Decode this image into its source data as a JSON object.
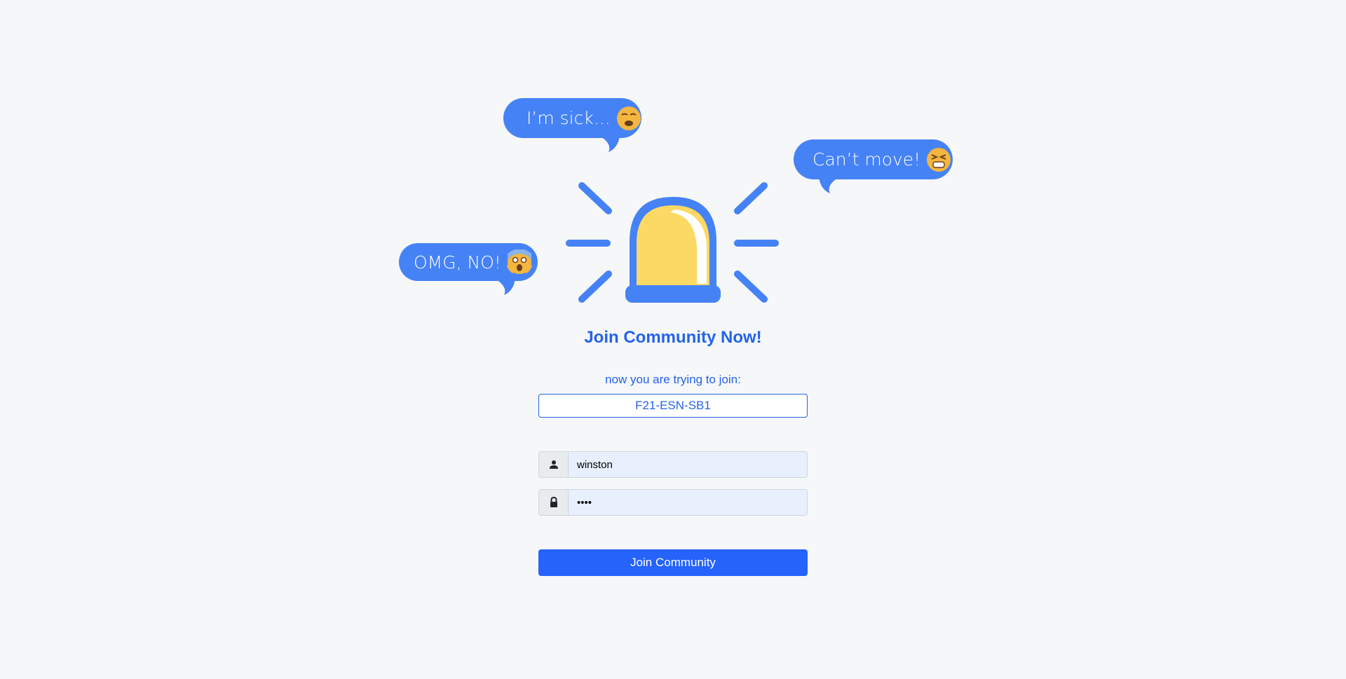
{
  "bubbles": {
    "sick": {
      "text": "I’m sick...",
      "emoji": "weary-face-emoji"
    },
    "cant_move": {
      "text": "Can’t move!",
      "emoji": "tired-face-emoji"
    },
    "omg": {
      "text": "OMG, NO!",
      "emoji": "screaming-face-emoji"
    }
  },
  "illustration": {
    "icon": "siren-alarm-icon",
    "body_color": "#fcd964",
    "accent_color": "#4582f5"
  },
  "form": {
    "title": "Join Community Now!",
    "subtitle": "now you are trying to join:",
    "community_name": "F21-ESN-SB1",
    "username": {
      "icon": "user-icon",
      "value": "winston"
    },
    "password": {
      "icon": "lock-icon",
      "value": "••••"
    },
    "submit_label": "Join Community"
  },
  "colors": {
    "primary": "#2563fb",
    "bubble": "#4582f5",
    "background": "#f6f7f9",
    "autofill": "#e8f0fe"
  }
}
